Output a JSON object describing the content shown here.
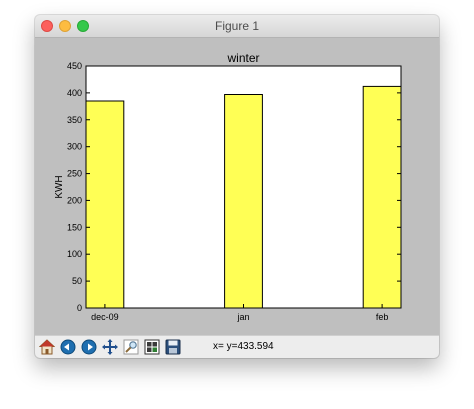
{
  "window": {
    "title": "Figure 1"
  },
  "toolbar": {
    "status": "x= y=433.594",
    "icons": [
      "home-icon",
      "back-icon",
      "forward-icon",
      "pan-icon",
      "zoom-icon",
      "configure-subplots-icon",
      "save-icon"
    ]
  },
  "colors": {
    "bar": "#ffff55",
    "figure_bg": "#bfbfbf",
    "axes_bg": "#ffffff"
  },
  "chart_data": {
    "type": "bar",
    "title": "winter",
    "xlabel": "",
    "ylabel": "KWH",
    "categories": [
      "dec-09",
      "jan",
      "feb"
    ],
    "values": [
      385,
      397,
      412
    ],
    "ylim": [
      0,
      450
    ],
    "yticks": [
      0,
      50,
      100,
      150,
      200,
      250,
      300,
      350,
      400,
      450
    ],
    "grid": false
  }
}
